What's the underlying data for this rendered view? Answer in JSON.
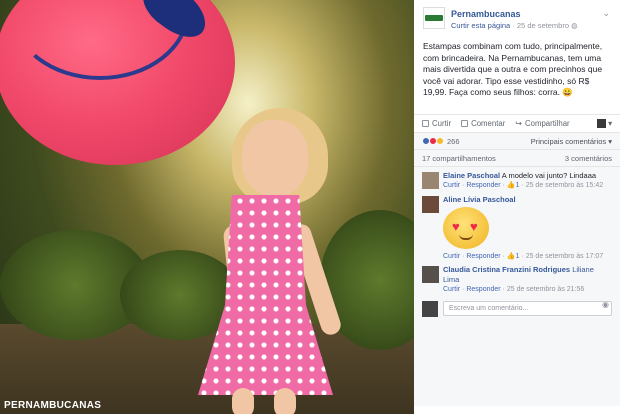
{
  "photo": {
    "caption": "PERNAMBUCANAS"
  },
  "post": {
    "page_name": "Pernambucanas",
    "page_like": "Curtir esta página",
    "date": "25 de setembro",
    "globe_icon": "globe-icon",
    "text": "Estampas combinam com tudo, principalmente, com brincadeira. Na Pernambucanas, tem uma mais divertida que a outra e com precinhos que você vai adorar. Tipo esse vestidinho, só R$ 19,99. Faça como seus filhos: corra. 😀"
  },
  "actions": {
    "like": "Curtir",
    "comment": "Comentar",
    "share": "Compartilhar"
  },
  "reactions": {
    "count": "266",
    "sort": "Principais comentários"
  },
  "stats": {
    "shares": "17 compartilhamentos",
    "comments": "3 comentários"
  },
  "comments": [
    {
      "author": "Elaine Paschoal",
      "text": "A modelo vai junto? Lindaaa",
      "like": "Curtir",
      "reply": "Responder",
      "likes": "1",
      "time": "25 de setembro às 15:42"
    },
    {
      "author": "Aline Lívia Paschoal",
      "text": "",
      "like": "Curtir",
      "reply": "Responder",
      "likes": "1",
      "time": "25 de setembro às 17:07"
    },
    {
      "author": "Claudia Cristina Franzini Rodrigues",
      "text": "Liliane Lima",
      "like": "Curtir",
      "reply": "Responder",
      "likes": "",
      "time": "25 de setembro às 21:56"
    }
  ],
  "composer": {
    "placeholder": "Escreva um comentário..."
  },
  "colors": {
    "link": "#365899",
    "meta": "#90949c",
    "panel_bg": "#f6f7f9"
  }
}
